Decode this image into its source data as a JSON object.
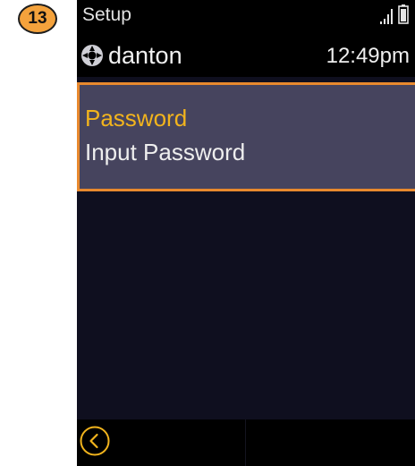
{
  "step": {
    "number": "13"
  },
  "status": {
    "title": "Setup",
    "username": "danton",
    "time": "12:49pm"
  },
  "menu": {
    "selected_item": {
      "title": "Password",
      "subtitle": "Input Password"
    }
  },
  "softkeys": {
    "left_icon": "back-chevron-icon"
  },
  "icons": {
    "status": [
      "signal-icon",
      "battery-icon"
    ],
    "user": "user-status-icon"
  },
  "colors": {
    "accent_orange": "#e8892e",
    "title_yellow": "#f2b41d",
    "selection_bg": "#46445e",
    "screen_bg": "#0f0f1f",
    "badge_fill": "#f4a23c"
  }
}
